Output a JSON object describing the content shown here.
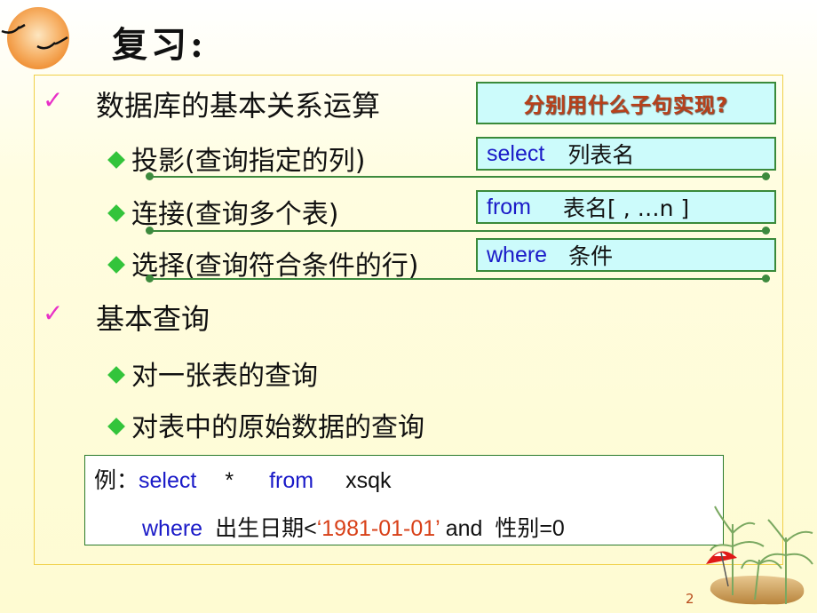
{
  "slide": {
    "title": "复习:",
    "question_box": "分别用什么子句实现?",
    "sections": [
      {
        "heading": "数据库的基本关系运算",
        "items": [
          {
            "label": "投影(查询指定的列)",
            "clause_keyword": "select",
            "clause_value": "列表名"
          },
          {
            "label": "连接(查询多个表)",
            "clause_keyword": "from",
            "clause_value": "表名[ , …n ]"
          },
          {
            "label": "选择(查询符合条件的行)",
            "clause_keyword": "where",
            "clause_value": "条件"
          }
        ]
      },
      {
        "heading": "基本查询",
        "items": [
          {
            "label": "对一张表的查询"
          },
          {
            "label": "对表中的原始数据的查询"
          }
        ]
      }
    ],
    "example": {
      "prefix": "例：",
      "line1": {
        "kw1": "select",
        "star": "*",
        "kw2": "from",
        "table": "xsqk"
      },
      "line2": {
        "kw": "where",
        "field": "出生日期<",
        "date": "‘1981-01-01’",
        "and": " and  性别=0"
      }
    },
    "page_number": "2"
  },
  "colors": {
    "check": "#e830c8",
    "diamond": "#33c43b",
    "keyword": "#1a1ac8",
    "question": "#b8401a",
    "date_literal": "#d84018",
    "box_fill": "#ccfbfb",
    "box_border": "#3a8a3a"
  }
}
